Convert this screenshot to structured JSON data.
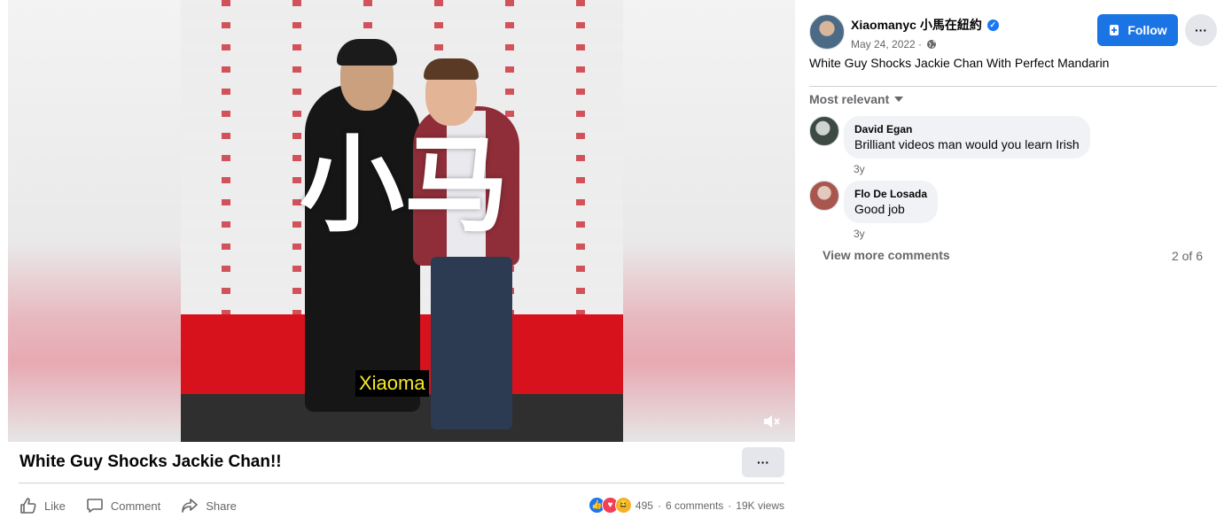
{
  "video": {
    "overlay_text": "小马",
    "subtitle": "Xiaoma",
    "title": "White Guy Shocks Jackie Chan!!",
    "more_label": "···",
    "mute_icon": "speaker-muted-icon"
  },
  "actions": {
    "like": "Like",
    "comment": "Comment",
    "share": "Share"
  },
  "stats": {
    "reactions": [
      "like",
      "love",
      "haha"
    ],
    "reaction_count": "495",
    "separator": "·",
    "comments": "6 comments",
    "views": "19K views"
  },
  "post": {
    "author": "Xiaomanyc 小馬在紐約",
    "date": "May 24, 2022 ·",
    "follow_label": "Follow",
    "more_label": "···",
    "caption": "White Guy Shocks Jackie Chan With Perfect Mandarin"
  },
  "comments": {
    "sort_label": "Most relevant",
    "items": [
      {
        "name": "David Egan",
        "text": "Brilliant videos man would you learn Irish",
        "time": "3y"
      },
      {
        "name": "Flo De Losada",
        "text": "Good job",
        "time": "3y"
      }
    ],
    "view_more": "View more comments",
    "page_count": "2 of 6"
  },
  "colors": {
    "accent": "#1b74e4",
    "like": "#1877f2",
    "love": "#f33e58",
    "haha": "#f7b125"
  }
}
